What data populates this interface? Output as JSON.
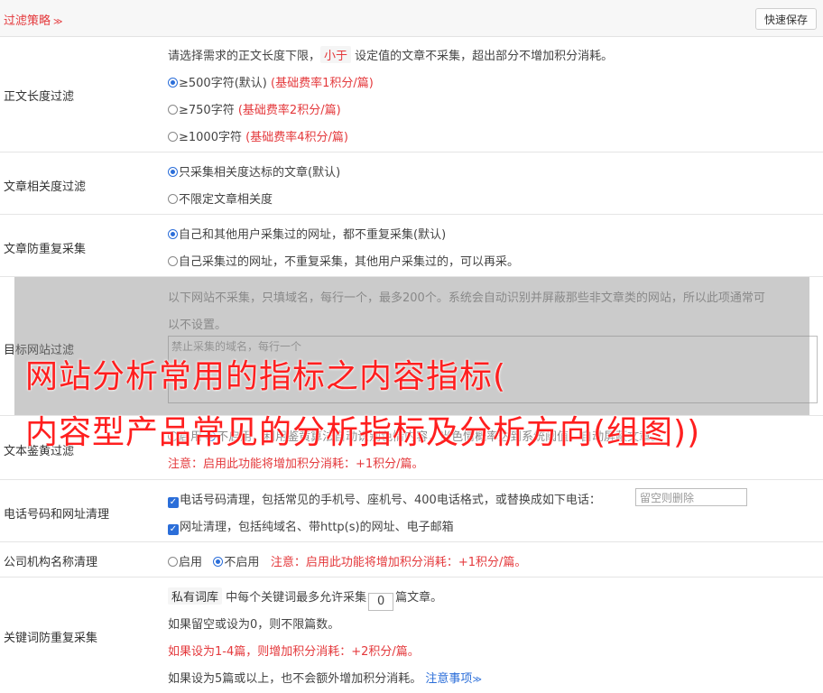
{
  "header": {
    "title": "过滤策略",
    "save_label": "快速保存"
  },
  "length_filter": {
    "label": "正文长度过滤",
    "desc_a": "请选择需求的正文长度下限，",
    "desc_tag": "小于",
    "desc_b": "设定值的文章不采集，超出部分不增加积分消耗。",
    "options": [
      {
        "text": "≥500字符(默认)",
        "note": "(基础费率1积分/篇)",
        "checked": true
      },
      {
        "text": "≥750字符",
        "note": "(基础费率2积分/篇)",
        "checked": false
      },
      {
        "text": "≥1000字符",
        "note": "(基础费率4积分/篇)",
        "checked": false
      }
    ]
  },
  "relevance": {
    "label": "文章相关度过滤",
    "options": [
      {
        "text": "只采集相关度达标的文章(默认)",
        "checked": true
      },
      {
        "text": "不限定文章相关度",
        "checked": false
      }
    ]
  },
  "dedupe": {
    "label": "文章防重复采集",
    "options": [
      {
        "text": "自己和其他用户采集过的网址，都不重复采集(默认)",
        "checked": true
      },
      {
        "text": "自己采集过的网址，不重复采集，其他用户采集过的，可以再采。",
        "checked": false
      }
    ]
  },
  "site_filter": {
    "label": "目标网站过滤",
    "desc_line1": "以下网站不采集，只填域名，每行一个，最多200个。系统会自动识别并屏蔽那些非文章类的网站，所以此项通常可",
    "desc_line2": "以不设置。",
    "placeholder": "禁止采集的域名，每行一个"
  },
  "porn_filter": {
    "label": "文本鉴黄过滤",
    "option_on": "启用",
    "option_off": "不启用",
    "desc": "，利用鉴黄算法自动识别色情内容，当色情概率达到系统阈值，自动屏蔽文章。",
    "note": "注意：启用此功能将增加积分消耗：+1积分/篇。"
  },
  "phone_clean": {
    "label": "电话号码和网址清理",
    "phone_text": "电话号码清理，包括常见的手机号、座机号、400电话格式，或替换成如下电话：",
    "phone_placeholder": "留空则删除",
    "url_text": "网址清理，包括纯域名、带http(s)的网址、电子邮箱"
  },
  "company_clean": {
    "label": "公司机构名称清理",
    "option_on": "启用",
    "option_off": "不启用",
    "note": "注意：启用此功能将增加积分消耗：+1积分/篇。"
  },
  "keyword_dedupe": {
    "label": "关键词防重复采集",
    "tag": "私有词库",
    "line1_a": "中每个关键词最多允许采集",
    "value": "0",
    "line1_b": "篇文章。",
    "line2": "如果留空或设为0，则不限篇数。",
    "line3": "如果设为1-4篇，则增加积分消耗：+2积分/篇。",
    "line4": "如果设为5篇或以上，也不会额外增加积分消耗。",
    "link": "注意事项"
  },
  "watermark": {
    "line1": "网站分析常用的指标之内容指标(",
    "line2": "内容型产品常见的分析指标及分析方向(组图))"
  },
  "colors": {
    "accent_red": "#e4393c",
    "radio_blue": "#2b6ed9"
  }
}
